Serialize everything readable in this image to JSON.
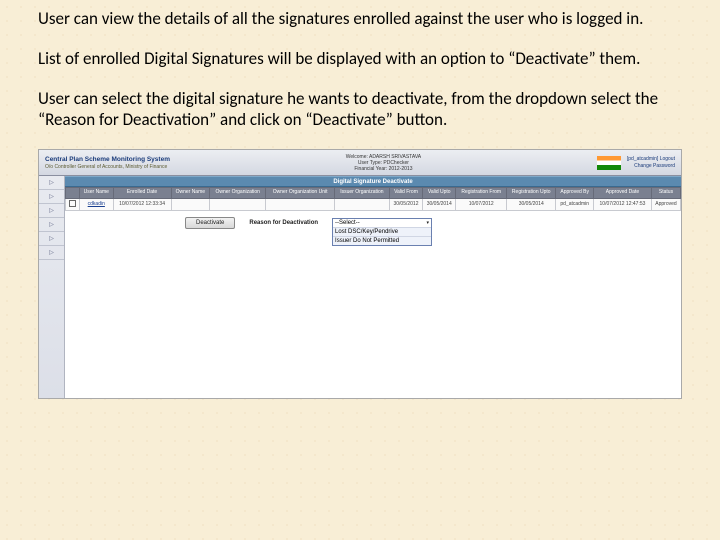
{
  "intro": {
    "p1": "User can view the details of all the signatures enrolled against the user who is logged in.",
    "p2": "List of enrolled Digital Signatures will be displayed with an option to “Deactivate” them.",
    "p3": "User can select the digital signature he wants to deactivate, from the dropdown select the “Reason for Deactivation” and click on “Deactivate” button."
  },
  "banner": {
    "title": "Central Plan Scheme Monitoring System",
    "subtitle": "O/o Controller General of Accounts, Ministry of Finance",
    "welcome": "Welcome: ADARSH SRIVASTAVA",
    "usertype": "User Type: PDChecker",
    "fy": "Financial Year: 2012-2013",
    "links": {
      "user": "[pd_atcadmin]",
      "logout": "Logout",
      "changepw": "Change Password"
    }
  },
  "section_title": "Digital Signature Deactivate",
  "table": {
    "headers": [
      "",
      "User Name",
      "Enrolled Date",
      "Owner Name",
      "Owner Organization",
      "Owner Organization Unit",
      "Issuer Organization",
      "Valid From",
      "Valid Upto",
      "Registration From",
      "Registration Upto",
      "Approved By",
      "Approved Date",
      "Status"
    ],
    "row": {
      "user_name": "cdkadin",
      "enrolled_date": "10/07/2012 12:33:34",
      "owner_name": "",
      "owner_org": "",
      "owner_org_unit": "",
      "issuer_org": "",
      "valid_from": "30/05/2012",
      "valid_upto": "30/05/2014",
      "reg_from": "10/07/2012",
      "reg_upto": "30/05/2014",
      "approved_by": "pd_atcadmin",
      "approved_date": "10/07/2012 12:47:53",
      "status": "Approved"
    }
  },
  "actions": {
    "deactivate_label": "Deactivate",
    "reason_label": "Reason for Deactivation",
    "dd_selected": "--Select--",
    "dd_options": [
      "Lost DSC/Key/Pendrive",
      "Issuer Do Not Permitted"
    ]
  }
}
